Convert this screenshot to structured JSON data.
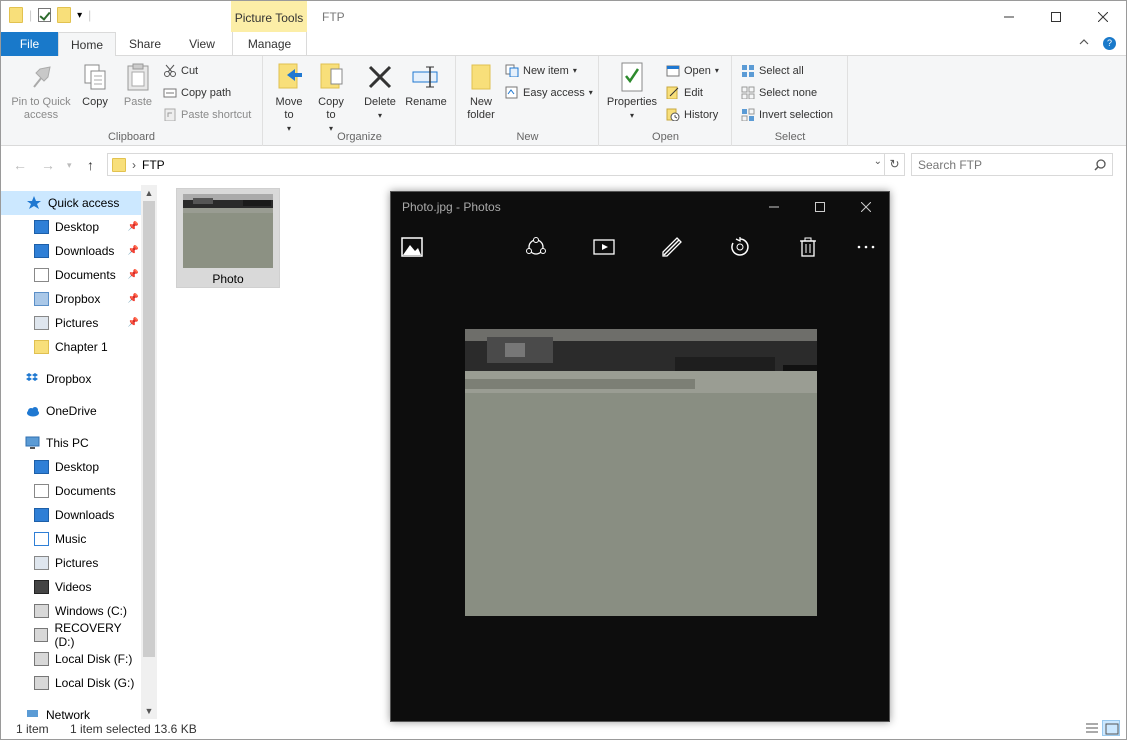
{
  "qat": {
    "customize_label": "▾"
  },
  "context_tab": "Picture Tools",
  "window_title": "FTP",
  "tabs": {
    "file": "File",
    "home": "Home",
    "share": "Share",
    "view": "View",
    "manage": "Manage"
  },
  "ribbon": {
    "clipboard": {
      "label": "Clipboard",
      "pin": "Pin to Quick access",
      "copy": "Copy",
      "paste": "Paste",
      "cut": "Cut",
      "copy_path": "Copy path",
      "paste_shortcut": "Paste shortcut"
    },
    "organize": {
      "label": "Organize",
      "move_to": "Move to",
      "copy_to": "Copy to",
      "delete": "Delete",
      "rename": "Rename"
    },
    "new": {
      "label": "New",
      "new_folder": "New folder",
      "new_item": "New item",
      "easy_access": "Easy access"
    },
    "open": {
      "label": "Open",
      "properties": "Properties",
      "open": "Open",
      "edit": "Edit",
      "history": "History"
    },
    "select": {
      "label": "Select",
      "select_all": "Select all",
      "select_none": "Select none",
      "invert": "Invert selection"
    }
  },
  "address": {
    "path": "FTP",
    "search_placeholder": "Search FTP"
  },
  "nav": {
    "quick_access": "Quick access",
    "qa_items": [
      {
        "label": "Desktop"
      },
      {
        "label": "Downloads"
      },
      {
        "label": "Documents"
      },
      {
        "label": "Dropbox"
      },
      {
        "label": "Pictures"
      },
      {
        "label": "Chapter 1"
      }
    ],
    "dropbox": "Dropbox",
    "onedrive": "OneDrive",
    "this_pc": "This PC",
    "pc_items": [
      {
        "label": "Desktop"
      },
      {
        "label": "Documents"
      },
      {
        "label": "Downloads"
      },
      {
        "label": "Music"
      },
      {
        "label": "Pictures"
      },
      {
        "label": "Videos"
      },
      {
        "label": "Windows (C:)"
      },
      {
        "label": "RECOVERY (D:)"
      },
      {
        "label": "Local Disk (F:)"
      },
      {
        "label": "Local Disk (G:)"
      }
    ],
    "network": "Network"
  },
  "file": {
    "name": "Photo"
  },
  "status": {
    "count": "1 item",
    "selected": "1 item selected",
    "size": "13.6 KB"
  },
  "photos": {
    "title": "Photo.jpg - Photos"
  }
}
